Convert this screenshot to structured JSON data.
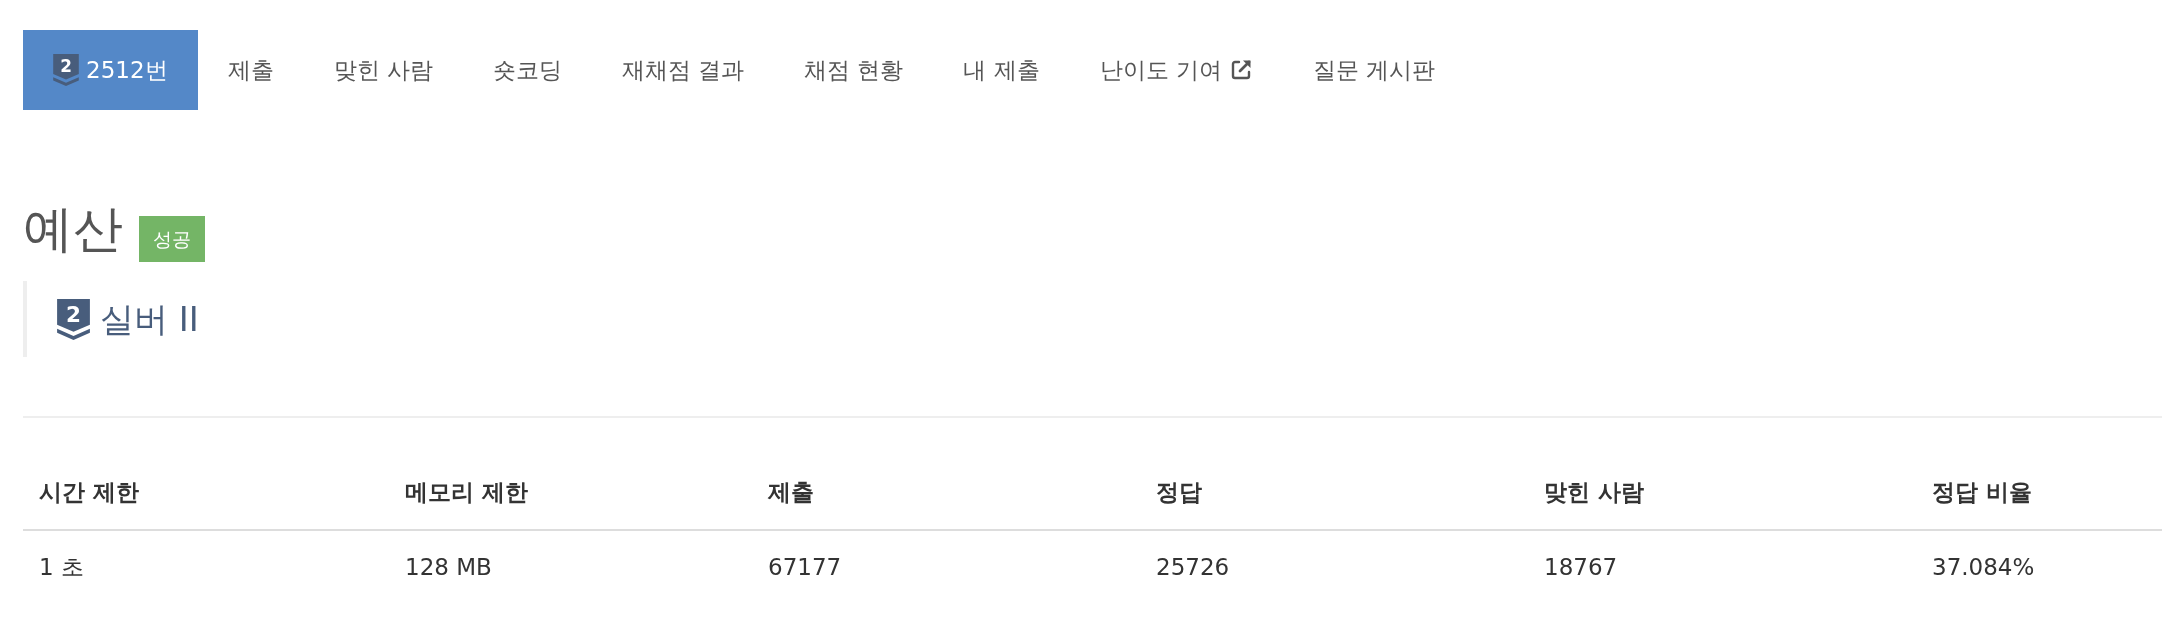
{
  "problem_tabs": [
    {
      "label": "2512번",
      "selected": true,
      "tier_digit": "2",
      "external": false
    },
    {
      "label": "제출",
      "selected": false,
      "external": false
    },
    {
      "label": "맞힌 사람",
      "selected": false,
      "external": false
    },
    {
      "label": "숏코딩",
      "selected": false,
      "external": false
    },
    {
      "label": "재채점 결과",
      "selected": false,
      "external": false
    },
    {
      "label": "채점 현황",
      "selected": false,
      "external": false
    },
    {
      "label": "내 제출",
      "selected": false,
      "external": false
    },
    {
      "label": "난이도 기여",
      "selected": false,
      "external": true
    },
    {
      "label": "질문 게시판",
      "selected": false,
      "external": false
    }
  ],
  "problem": {
    "title": "예산",
    "result_badge": "성공",
    "tier": {
      "digit": "2",
      "name": "실버 II"
    }
  },
  "info_table": {
    "columns": [
      "시간 제한",
      "메모리 제한",
      "제출",
      "정답",
      "맞힌 사람",
      "정답 비율"
    ],
    "rows": [
      [
        "1 초",
        "128 MB",
        "67177",
        "25726",
        "18767",
        "37.084%"
      ]
    ]
  }
}
